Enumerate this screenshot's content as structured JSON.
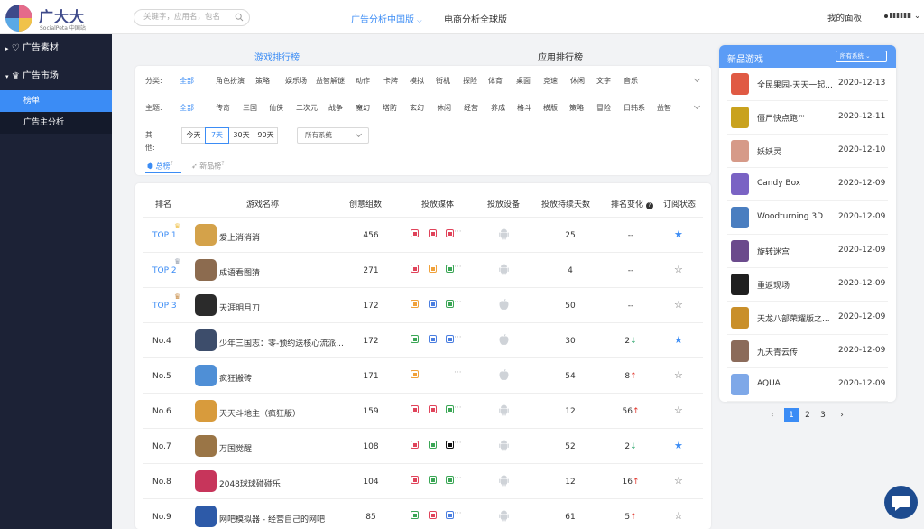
{
  "brand": {
    "name": "广大大",
    "sub": "SocialPeta 中国站"
  },
  "search": {
    "placeholder": "关键字，应用名，包名"
  },
  "nav": {
    "active": "广告分析中国版",
    "other": "电商分析全球版"
  },
  "header_right": {
    "panel": "我的面板",
    "user": "·"
  },
  "sidebar": {
    "items": [
      {
        "label": "广告素材"
      },
      {
        "label": "广告市场"
      }
    ],
    "subitems": [
      {
        "label": "榜单",
        "active": true
      },
      {
        "label": "广告主分析"
      }
    ]
  },
  "ranking_tabs": {
    "game": "游戏排行榜",
    "app": "应用排行榜"
  },
  "filters": {
    "category": {
      "label": "分类:",
      "options": [
        "全部",
        "角色扮演",
        "策略",
        "娱乐场",
        "益智解谜",
        "动作",
        "卡牌",
        "模拟",
        "街机",
        "探险",
        "体育",
        "桌面",
        "竞速",
        "休闲",
        "文字",
        "音乐"
      ],
      "selected": "全部"
    },
    "theme": {
      "label": "主题:",
      "options": [
        "全部",
        "传奇",
        "三国",
        "仙侠",
        "二次元",
        "战争",
        "魔幻",
        "塔防",
        "玄幻",
        "休闲",
        "经营",
        "养成",
        "格斗",
        "横版",
        "策略",
        "冒险",
        "日韩系",
        "益智"
      ],
      "selected": "全部"
    },
    "other": {
      "label": "其他:",
      "periods": [
        "今天",
        "7天",
        "30天",
        "90天"
      ],
      "selected": "7天",
      "system": "所有系统"
    }
  },
  "subtabs": {
    "total": "总榜",
    "new": "新品榜"
  },
  "table": {
    "headers": [
      "排名",
      "游戏名称",
      "创意组数",
      "投放媒体",
      "投放设备",
      "投放持续天数",
      "排名变化",
      "订阅状态"
    ],
    "rows": [
      {
        "rank": "TOP 1",
        "name": "爱上消消消",
        "count": "456",
        "days": "25",
        "change": "--",
        "dir": "",
        "sub": true,
        "icon": "#d4a24a",
        "media": [
          "#e0435a",
          "#e0435a",
          "#e0435a"
        ],
        "device": "android"
      },
      {
        "rank": "TOP 2",
        "name": "成语看图猜",
        "count": "271",
        "days": "4",
        "change": "--",
        "dir": "",
        "sub": false,
        "icon": "#8c6b4f",
        "media": [
          "#e0435a",
          "#f0a13a",
          "#3aa655"
        ],
        "device": "android"
      },
      {
        "rank": "TOP 3",
        "name": "天涯明月刀",
        "count": "172",
        "days": "50",
        "change": "--",
        "dir": "",
        "sub": false,
        "icon": "#2b2b2b",
        "media": [
          "#f0a13a",
          "#4a7ee0",
          "#3aa655"
        ],
        "device": "apple"
      },
      {
        "rank": "No.4",
        "name": "少年三国志：零-预约送核心流派...",
        "count": "172",
        "days": "30",
        "change": "2",
        "dir": "down",
        "sub": true,
        "icon": "#3d4d6b",
        "media": [
          "#3aa655",
          "#4a7ee0",
          "#4a7ee0"
        ],
        "device": "apple"
      },
      {
        "rank": "No.5",
        "name": "疯狂搬砖",
        "count": "171",
        "days": "54",
        "change": "8",
        "dir": "up",
        "sub": false,
        "icon": "#4f8fd6",
        "media": [
          "#f0a13a"
        ],
        "device": "apple"
      },
      {
        "rank": "No.6",
        "name": "天天斗地主（疯狂版）",
        "count": "159",
        "days": "12",
        "change": "56",
        "dir": "up",
        "sub": false,
        "icon": "#d89b3c",
        "media": [
          "#e0435a",
          "#e0435a",
          "#3aa655"
        ],
        "device": "android"
      },
      {
        "rank": "No.7",
        "name": "万国觉醒",
        "count": "108",
        "days": "52",
        "change": "2",
        "dir": "down",
        "sub": true,
        "icon": "#9a7546",
        "media": [
          "#e0435a",
          "#3aa655",
          "#111111"
        ],
        "device": "android"
      },
      {
        "rank": "No.8",
        "name": "2048球球碰碰乐",
        "count": "104",
        "days": "12",
        "change": "16",
        "dir": "up",
        "sub": false,
        "icon": "#c7355b",
        "media": [
          "#e0435a",
          "#3aa655",
          "#3aa655"
        ],
        "device": "android"
      },
      {
        "rank": "No.9",
        "name": "网吧模拟器 - 经营自己的网吧",
        "count": "85",
        "days": "61",
        "change": "5",
        "dir": "up",
        "sub": false,
        "icon": "#2d5aa8",
        "media": [
          "#3aa655",
          "#e0435a",
          "#4a7ee0"
        ],
        "device": "android"
      }
    ]
  },
  "new_games": {
    "title": "新品游戏",
    "system": "所有系统",
    "items": [
      {
        "name": "全民果园-天天一起...",
        "date": "2020-12-13",
        "icon": "#e05a44"
      },
      {
        "name": "僵尸快点跑™",
        "date": "2020-12-11",
        "icon": "#c9a21e"
      },
      {
        "name": "妖妖灵",
        "date": "2020-12-10",
        "icon": "#d69a88"
      },
      {
        "name": "Candy Box",
        "date": "2020-12-09",
        "icon": "#7a63c4"
      },
      {
        "name": "Woodturning 3D",
        "date": "2020-12-09",
        "icon": "#4a7ec0"
      },
      {
        "name": "旋转迷宫",
        "date": "2020-12-09",
        "icon": "#6b4a8c"
      },
      {
        "name": "重返现场",
        "date": "2020-12-09",
        "icon": "#1f1f1f"
      },
      {
        "name": "天龙八部荣耀版之...",
        "date": "2020-12-09",
        "icon": "#c98f2a"
      },
      {
        "name": "九天青云传",
        "date": "2020-12-09",
        "icon": "#8b6b5a"
      },
      {
        "name": "AQUA",
        "date": "2020-12-09",
        "icon": "#7ea8e8"
      }
    ]
  },
  "pager": {
    "prev": "‹",
    "pages": [
      "1",
      "2",
      "3"
    ],
    "next": "›",
    "current": "1"
  },
  "colors": {
    "accent": "#3b8cf5",
    "sidebar": "#1c2236",
    "up": "#e0352b",
    "down": "#2aa46a",
    "star_on": "#3b8cf5"
  }
}
